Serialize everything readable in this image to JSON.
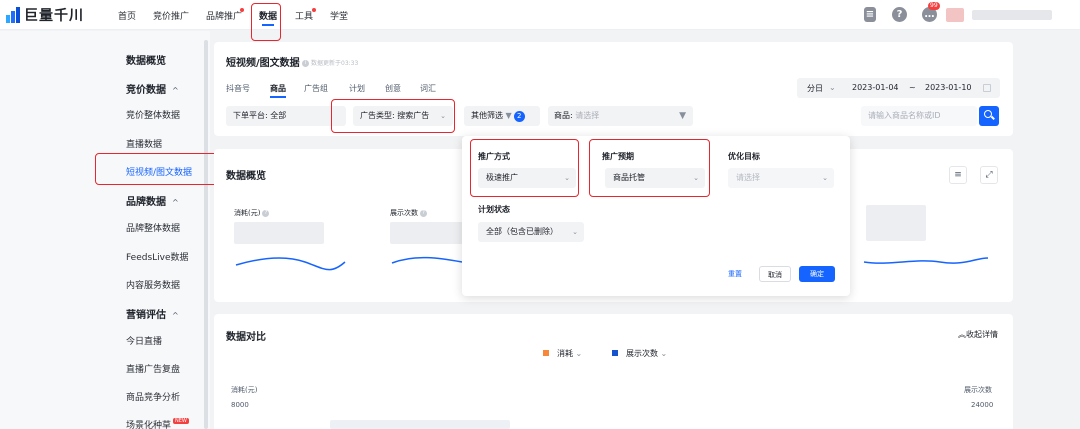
{
  "brand": {
    "name": "巨量千川"
  },
  "topnav": {
    "items": [
      "首页",
      "竞价推广",
      "品牌推广",
      "数据",
      "工具",
      "学堂"
    ],
    "active": "数据",
    "notification_badge": "99"
  },
  "sidebar": {
    "overview": "数据概览",
    "groups": [
      {
        "label": "竞价数据",
        "items": [
          "竞价整体数据",
          "直播数据",
          "短视频/图文数据"
        ]
      },
      {
        "label": "品牌数据",
        "items": [
          "品牌整体数据",
          "FeedsLive数据",
          "内容服务数据"
        ]
      },
      {
        "label": "营销评估",
        "items": [
          "今日直播",
          "直播广告复盘",
          "商品竞争分析",
          "场景化种草"
        ]
      }
    ],
    "active_item": "短视频/图文数据",
    "new_tag": "NEW"
  },
  "page": {
    "title": "短视频/图文数据",
    "update_note": "数据更新于03:33",
    "tabs": [
      "抖音号",
      "商品",
      "广告组",
      "计划",
      "创意",
      "词汇"
    ],
    "active_tab": "商品",
    "date": {
      "granularity": "分日",
      "start": "2023-01-04",
      "separator": "~",
      "end": "2023-01-10"
    }
  },
  "filters": {
    "platform": "下单平台: 全部",
    "ad_type": "广告类型: 搜索广告",
    "other": "其他筛选",
    "other_count": "2",
    "product_label": "商品:",
    "product_placeholder": "请选择",
    "search_placeholder": "请输入商品名称或ID"
  },
  "overview": {
    "title": "数据概览",
    "metrics": [
      {
        "label": "消耗(元)"
      },
      {
        "label": "展示次数"
      }
    ]
  },
  "popover": {
    "promo_method": {
      "label": "推广方式",
      "value": "极速推广"
    },
    "promo_expect": {
      "label": "推广预期",
      "value": "商品托管"
    },
    "optimize_goal": {
      "label": "优化目标",
      "placeholder": "请选择"
    },
    "plan_status": {
      "label": "计划状态",
      "value": "全部（包含已删除）"
    },
    "buttons": {
      "reset": "重置",
      "cancel": "取消",
      "confirm": "确定"
    }
  },
  "compare": {
    "title": "数据对比",
    "collapse": "收起详情",
    "legend": [
      {
        "label": "消耗",
        "color": "#f7873a"
      },
      {
        "label": "展示次数",
        "color": "#1664ff"
      }
    ],
    "left_axis": {
      "label": "消耗(元)",
      "top_value": "8000"
    },
    "right_axis": {
      "label": "展示次数",
      "top_value": "24000"
    }
  },
  "colors": {
    "accent": "#1664ff",
    "highlight": "#e8262f"
  }
}
